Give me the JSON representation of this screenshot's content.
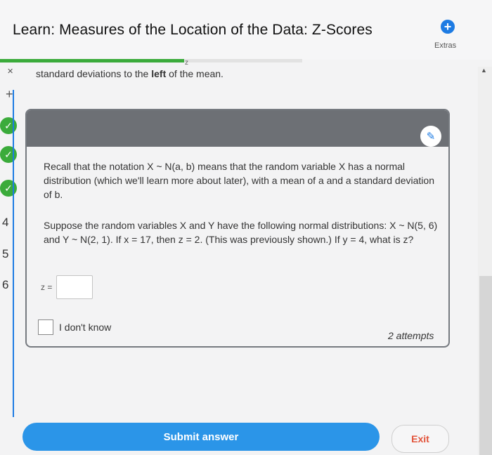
{
  "header": {
    "title": "Learn: Measures of the Location of the Data: Z-Scores",
    "extras_label": "Extras",
    "progress_fraction": 0.61
  },
  "rail": {
    "numbers": [
      "4",
      "5",
      "6"
    ]
  },
  "content": {
    "intro_prefix": "standard deviations to the ",
    "intro_bold": "left",
    "intro_suffix": " of the mean.",
    "stray_char": "z"
  },
  "question": {
    "p1": "Recall that the notation X ~ N(a, b) means that the random variable X has a normal distribution (which we'll learn more about later), with a mean of a and a standard deviation of b.",
    "p2": "Suppose the random variables X and Y have the following normal distributions: X ~ N(5, 6) and Y ~ N(2, 1). If x = 17, then z = 2. (This was previously shown.) If y = 4, what is z?",
    "answer_label": "z =",
    "answer_value": "",
    "idk_label": "I don't know",
    "attempts": "2 attempts"
  },
  "footer": {
    "submit_label": "Submit answer",
    "exit_label": "Exit"
  },
  "colors": {
    "accent": "#2b95e8",
    "success": "#3bab3b",
    "exit": "#e2533a"
  }
}
